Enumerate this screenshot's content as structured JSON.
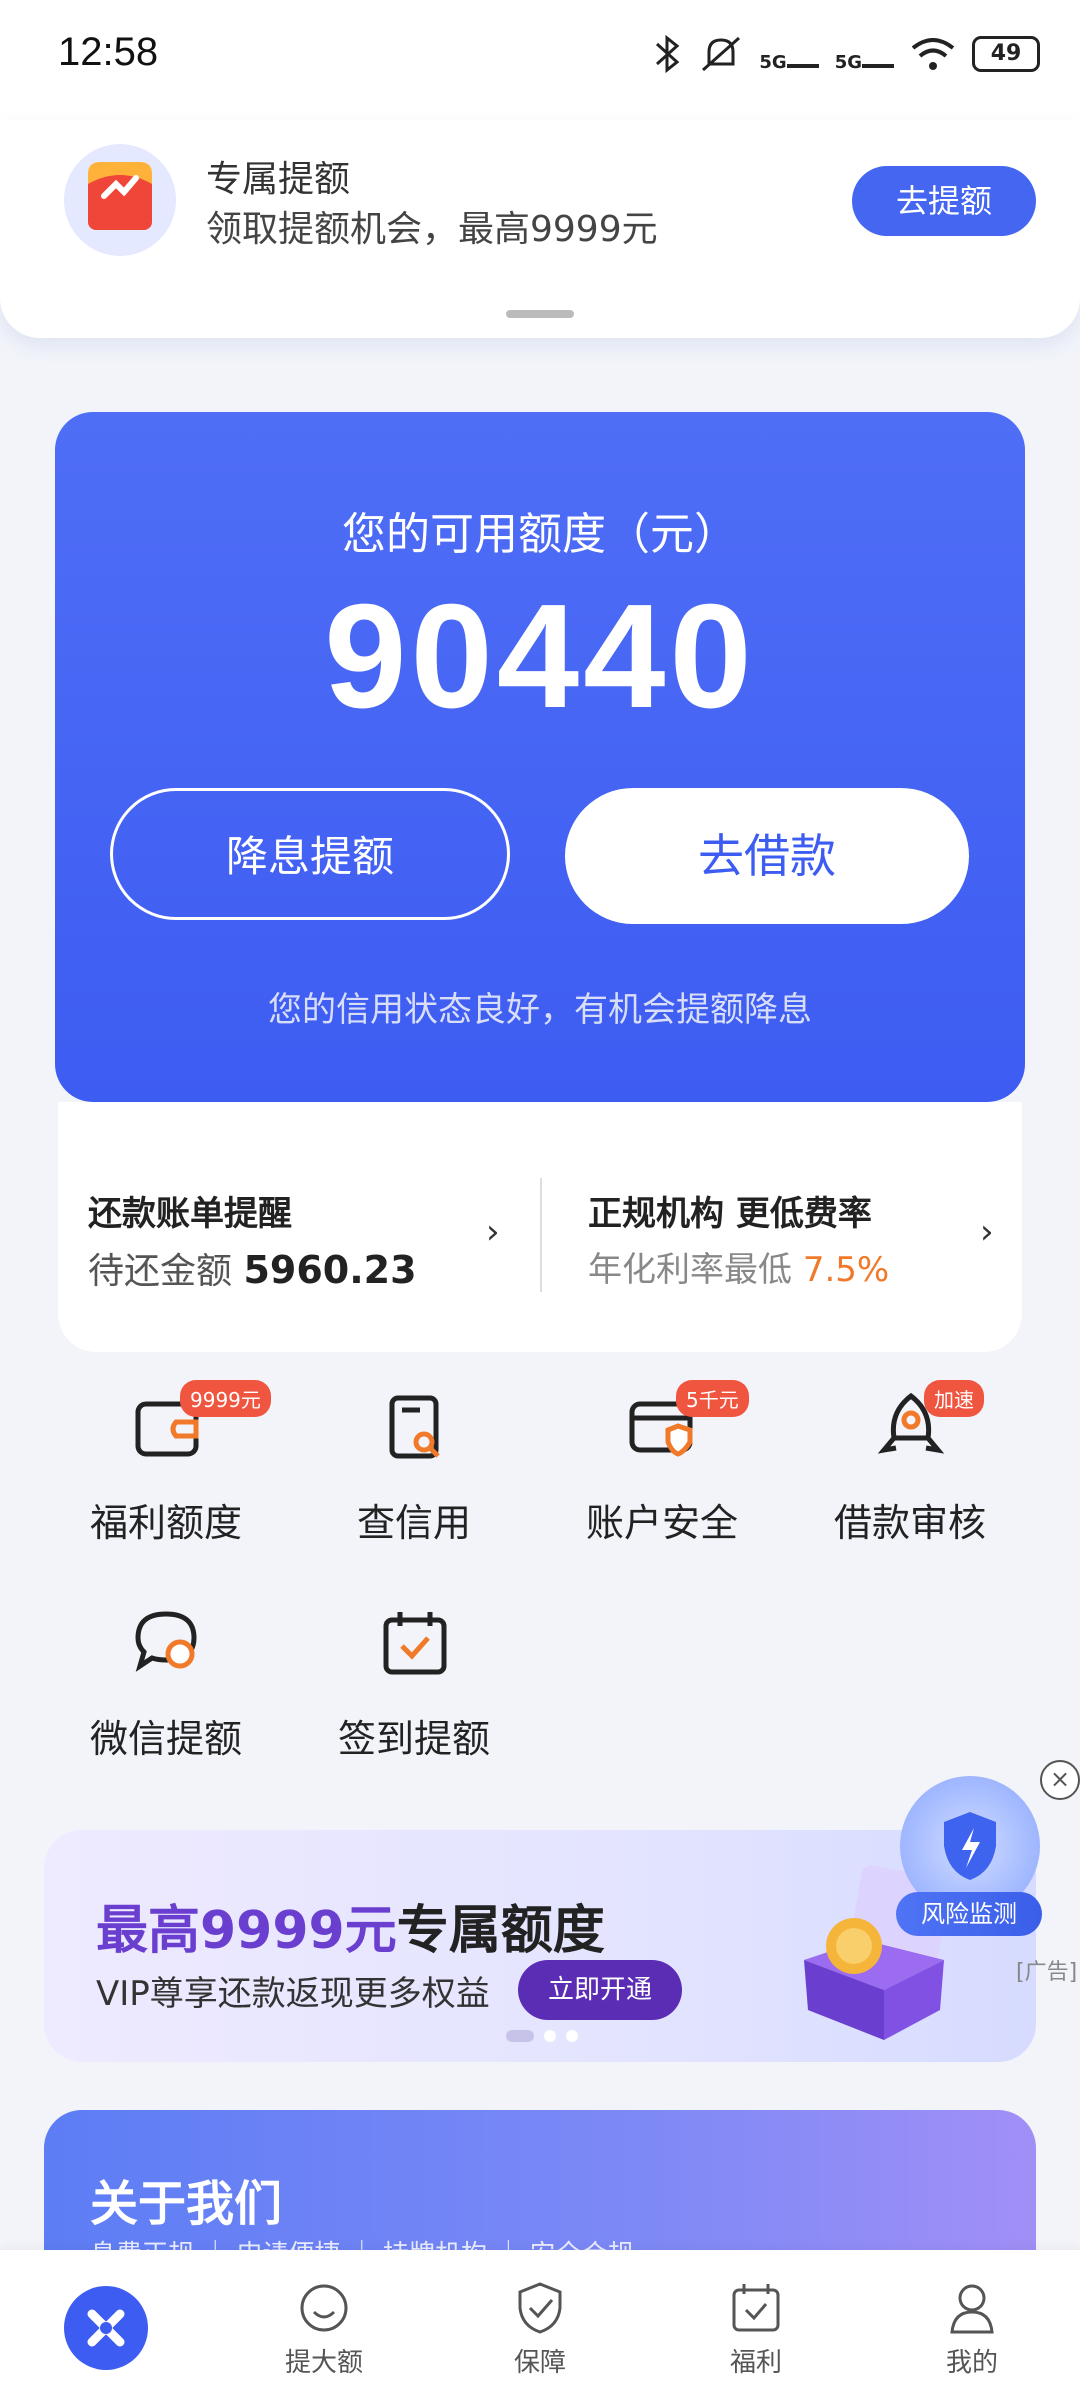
{
  "status_bar": {
    "time": "12:58",
    "battery": "49",
    "network": [
      "5G",
      "5G"
    ]
  },
  "notification": {
    "title": "专属提额",
    "subtitle": "领取提额机会，最高9999元",
    "button": "去提额"
  },
  "quota_card": {
    "label": "您的可用额度（元）",
    "amount": "90440",
    "left_button": "降息提额",
    "right_button": "去借款",
    "note": "您的信用状态良好，有机会提额降息"
  },
  "info": {
    "left_title": "还款账单提醒",
    "left_sub_prefix": "待还金额 ",
    "left_amount": "5960.23",
    "right_title": "正规机构 更低费率",
    "right_sub_prefix": "年化利率最低 ",
    "right_rate": "7.5%"
  },
  "features": [
    {
      "label": "福利额度",
      "badge": "9999元",
      "icon": "wallet-icon"
    },
    {
      "label": "查信用",
      "badge": "",
      "icon": "credit-report-icon"
    },
    {
      "label": "账户安全",
      "badge": "5千元",
      "icon": "card-shield-icon"
    },
    {
      "label": "借款审核",
      "badge": "加速",
      "icon": "rocket-icon"
    },
    {
      "label": "微信提额",
      "badge": "",
      "icon": "chat-icon"
    },
    {
      "label": "签到提额",
      "badge": "",
      "icon": "calendar-check-icon"
    }
  ],
  "promo": {
    "highlight": "最高9999元",
    "title_rest": "专属额度",
    "subtitle": "VIP尊享还款返现更多权益",
    "button": "立即开通"
  },
  "risk_float": {
    "label": "风险监测",
    "ad_tag": "[广告]"
  },
  "about": {
    "title": "关于我们",
    "tags": "息费正规 ｜ 申请便捷 ｜ 持牌机构 ｜ 安全合规"
  },
  "nav": [
    {
      "label": "提大额",
      "icon": "face-icon"
    },
    {
      "label": "保障",
      "icon": "shield-check-icon"
    },
    {
      "label": "福利",
      "icon": "calendar-check-icon"
    },
    {
      "label": "我的",
      "icon": "user-icon"
    }
  ],
  "colors": {
    "primary": "#3d5cf2",
    "accent_orange": "#f07a2a",
    "badge_red": "#f05540",
    "promo_purple": "#6a3fd0"
  }
}
